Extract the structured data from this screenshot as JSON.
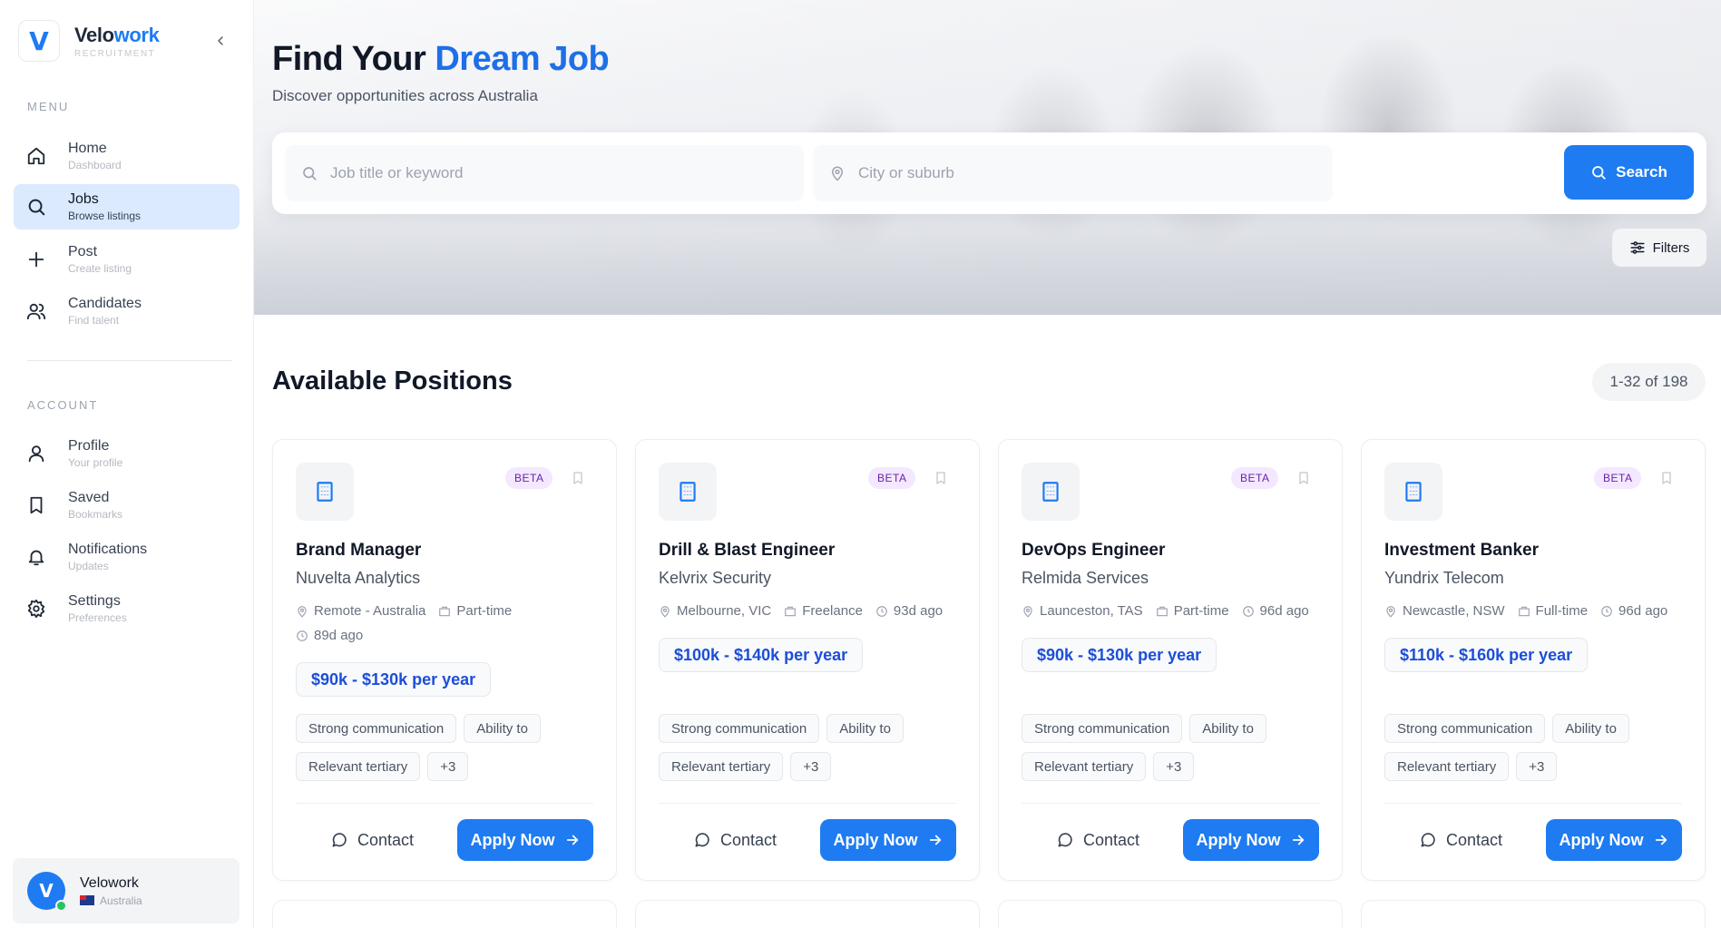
{
  "brand": {
    "logo_letter": "V",
    "name_part1": "Velo",
    "name_part2": "work",
    "subtitle": "RECRUITMENT"
  },
  "sidebar": {
    "menu_label": "MENU",
    "menu_items": [
      {
        "label": "Home",
        "desc": "Dashboard",
        "icon": "home-icon"
      },
      {
        "label": "Jobs",
        "desc": "Browse listings",
        "icon": "search-icon",
        "active": true
      },
      {
        "label": "Post",
        "desc": "Create listing",
        "icon": "plus-icon"
      },
      {
        "label": "Candidates",
        "desc": "Find talent",
        "icon": "users-icon"
      }
    ],
    "account_label": "ACCOUNT",
    "account_items": [
      {
        "label": "Profile",
        "desc": "Your profile",
        "icon": "user-icon"
      },
      {
        "label": "Saved",
        "desc": "Bookmarks",
        "icon": "bookmark-icon"
      },
      {
        "label": "Notifications",
        "desc": "Updates",
        "icon": "bell-icon"
      },
      {
        "label": "Settings",
        "desc": "Preferences",
        "icon": "gear-icon"
      }
    ],
    "user": {
      "name": "Velowork",
      "country": "Australia"
    }
  },
  "hero": {
    "title_part1": "Find Your ",
    "title_part2": "Dream Job",
    "subtitle": "Discover opportunities across Australia",
    "keyword_placeholder": "Job title or keyword",
    "location_placeholder": "City or suburb",
    "search_label": "Search",
    "filters_label": "Filters"
  },
  "main": {
    "section_title": "Available Positions",
    "count": "1-32 of 198",
    "beta_label": "BETA",
    "contact_label": "Contact",
    "apply_label": "Apply Now",
    "jobs": [
      {
        "title": "Brand Manager",
        "company": "Nuvelta Analytics",
        "location": "Remote - Australia",
        "type": "Part-time",
        "posted": "89d ago",
        "salary": "$90k - $130k per year",
        "tags": [
          "Strong communication",
          "Ability to",
          "Relevant tertiary",
          "+3"
        ]
      },
      {
        "title": "Drill & Blast Engineer",
        "company": "Kelvrix Security",
        "location": "Melbourne, VIC",
        "type": "Freelance",
        "posted": "93d ago",
        "salary": "$100k - $140k per year",
        "tags": [
          "Strong communication",
          "Ability to",
          "Relevant tertiary",
          "+3"
        ]
      },
      {
        "title": "DevOps Engineer",
        "company": "Relmida Services",
        "location": "Launceston, TAS",
        "type": "Part-time",
        "posted": "96d ago",
        "salary": "$90k - $130k per year",
        "tags": [
          "Strong communication",
          "Ability to",
          "Relevant tertiary",
          "+3"
        ]
      },
      {
        "title": "Investment Banker",
        "company": "Yundrix Telecom",
        "location": "Newcastle, NSW",
        "type": "Full-time",
        "posted": "96d ago",
        "salary": "$110k - $160k per year",
        "tags": [
          "Strong communication",
          "Ability to",
          "Relevant tertiary",
          "+3"
        ]
      }
    ]
  },
  "colors": {
    "accent": "#1e7bf2",
    "active_nav_bg": "#dbeafe",
    "beta_bg": "#f3e8ff",
    "beta_text": "#6b21a8",
    "online": "#22c55e"
  }
}
